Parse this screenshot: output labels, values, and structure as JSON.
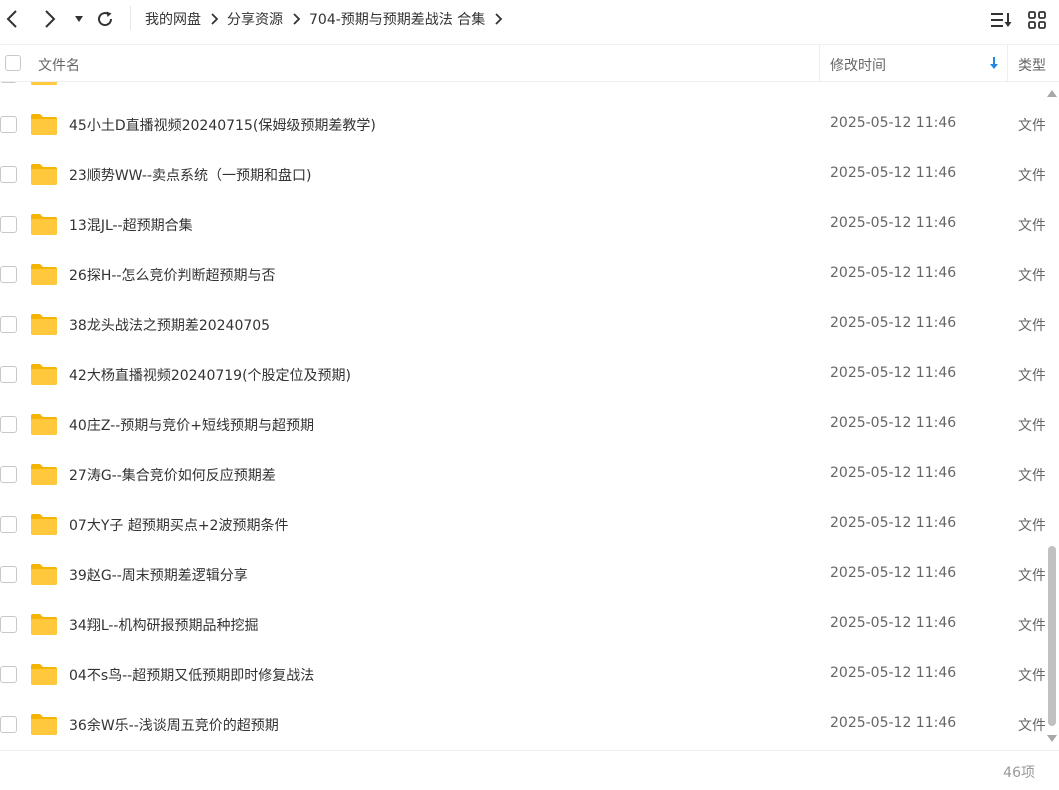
{
  "nav": {
    "back_icon": "chevron-left-icon",
    "forward_icon": "chevron-right-icon",
    "history_icon": "caret-down-icon",
    "refresh_icon": "refresh-icon"
  },
  "breadcrumb": [
    {
      "label": "我的网盘"
    },
    {
      "label": "分享资源"
    },
    {
      "label": "704-预期与预期差战法 合集"
    }
  ],
  "toolbar": {
    "sort_icon": "sort-list-icon",
    "grid_icon": "grid-view-icon"
  },
  "columns": {
    "name": "文件名",
    "modified": "修改时间",
    "type": "类型"
  },
  "rows": [
    {
      "name": "45小土D直播视频20240715(保姆级预期差教学)",
      "time": "2025-05-12 11:46",
      "type": "文件夹"
    },
    {
      "name": "23顺势WW--卖点系统（一预期和盘口)",
      "time": "2025-05-12 11:46",
      "type": "文件夹"
    },
    {
      "name": "13混JL--超预期合集",
      "time": "2025-05-12 11:46",
      "type": "文件夹"
    },
    {
      "name": "26探H--怎么竞价判断超预期与否",
      "time": "2025-05-12 11:46",
      "type": "文件夹"
    },
    {
      "name": "38龙头战法之预期差20240705",
      "time": "2025-05-12 11:46",
      "type": "文件夹"
    },
    {
      "name": "42大杨直播视频20240719(个股定位及预期)",
      "time": "2025-05-12 11:46",
      "type": "文件夹"
    },
    {
      "name": "40庄Z--预期与竞价+短线预期与超预期",
      "time": "2025-05-12 11:46",
      "type": "文件夹"
    },
    {
      "name": "27涛G--集合竞价如何反应预期差",
      "time": "2025-05-12 11:46",
      "type": "文件夹"
    },
    {
      "name": "07大Y子 超预期买点+2波预期条件",
      "time": "2025-05-12 11:46",
      "type": "文件夹"
    },
    {
      "name": "39赵G--周末预期差逻辑分享",
      "time": "2025-05-12 11:46",
      "type": "文件夹"
    },
    {
      "name": "34翔L--机构研报预期品种挖掘",
      "time": "2025-05-12 11:46",
      "type": "文件夹"
    },
    {
      "name": "04不s鸟--超预期又低预期即时修复战法",
      "time": "2025-05-12 11:46",
      "type": "文件夹"
    },
    {
      "name": "36余W乐--浅谈周五竞价的超预期",
      "time": "2025-05-12 11:46",
      "type": "文件夹"
    }
  ],
  "footer": {
    "count": "46项"
  },
  "colors": {
    "folder": "#FFC83D",
    "folder_back": "#F5B400",
    "accent": "#1E88E5"
  }
}
